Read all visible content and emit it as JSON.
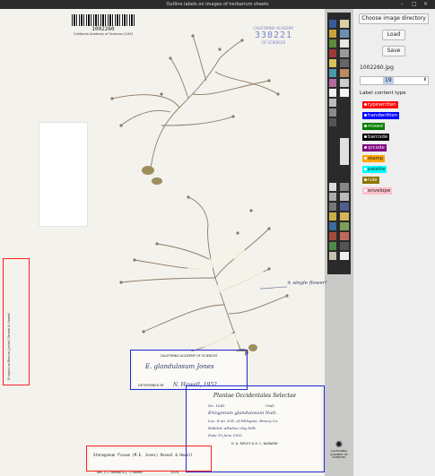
{
  "window": {
    "title": "Outline labels on images of herbarium sheets",
    "controls": [
      "–",
      "□",
      "×"
    ]
  },
  "sheet": {
    "barcode_number": "1002260",
    "institution": "California Academy of Sciences (CAS)",
    "stamp": {
      "line1": "CALIFORNIA ACADEMY",
      "number": "338221",
      "line3": "OF SCIENCES"
    },
    "side_label": "Eriogonum flexum (Jones) Reveal & Howell",
    "annotation_text": "± single flower!",
    "det_label": {
      "header": "CALIFORNIA ACADEMY OF SCIENCES",
      "name": "E. glandulosum Jones",
      "det_prefix": "DETERMINED BY",
      "det_name": "N. Howell, 1952"
    },
    "main_label": {
      "title": "Plantae Occidentales Selectae",
      "no": "No. 1045",
      "state": "Utah",
      "species": "Eriogonum glandulosum Nutt.",
      "locality": "Loc. 8 mi. N.E. of Hillsgate, Emery Co.",
      "habitat": "Habitat: alkaline clay hills",
      "date": "Date 10 June 1933",
      "collectors": "H. D. RIPLEY & R. C. BARNEBY"
    },
    "bottom_label": {
      "text": "Stenogonum flexum (M.E. Jones) Reveal & Howell",
      "det": "det. J. L. Reveal & J. T. Howell",
      "year": "1976"
    },
    "logo": {
      "name": "CALIFORNIA ACADEMY OF SCIENCES"
    }
  },
  "annotations": [
    {
      "type": "typewritten",
      "color": "#ff0000"
    },
    {
      "type": "handwritten",
      "color": "#0000ff"
    },
    {
      "type": "typewritten",
      "color": "#ff0000"
    },
    {
      "type": "handwritten",
      "color": "#0000ff"
    }
  ],
  "panel": {
    "choose_button": "Choose image directory",
    "load_button": "Load",
    "save_button": "Save",
    "filename": "1002260.jpg",
    "zoom_value": "19",
    "content_type_title": "Label content type",
    "types": [
      {
        "label": "typewritten",
        "bg": "#ff0000",
        "fg": "#ffffff"
      },
      {
        "label": "handwritten",
        "bg": "#0000ff",
        "fg": "#ffffff"
      },
      {
        "label": "mixed",
        "bg": "#007f00",
        "fg": "#ffffff"
      },
      {
        "label": "barcode",
        "bg": "#000000",
        "fg": "#ffffff"
      },
      {
        "label": "qrcode",
        "bg": "#800080",
        "fg": "#ffffff"
      },
      {
        "label": "stamp",
        "bg": "#ffa500",
        "fg": "#222222"
      },
      {
        "label": "palette",
        "bg": "#00ffff",
        "fg": "#222222"
      },
      {
        "label": "rule",
        "bg": "#8b7500",
        "fg": "#ffffff"
      },
      {
        "label": "envelope",
        "bg": "#ffc0cb",
        "fg": "#222222"
      }
    ]
  }
}
